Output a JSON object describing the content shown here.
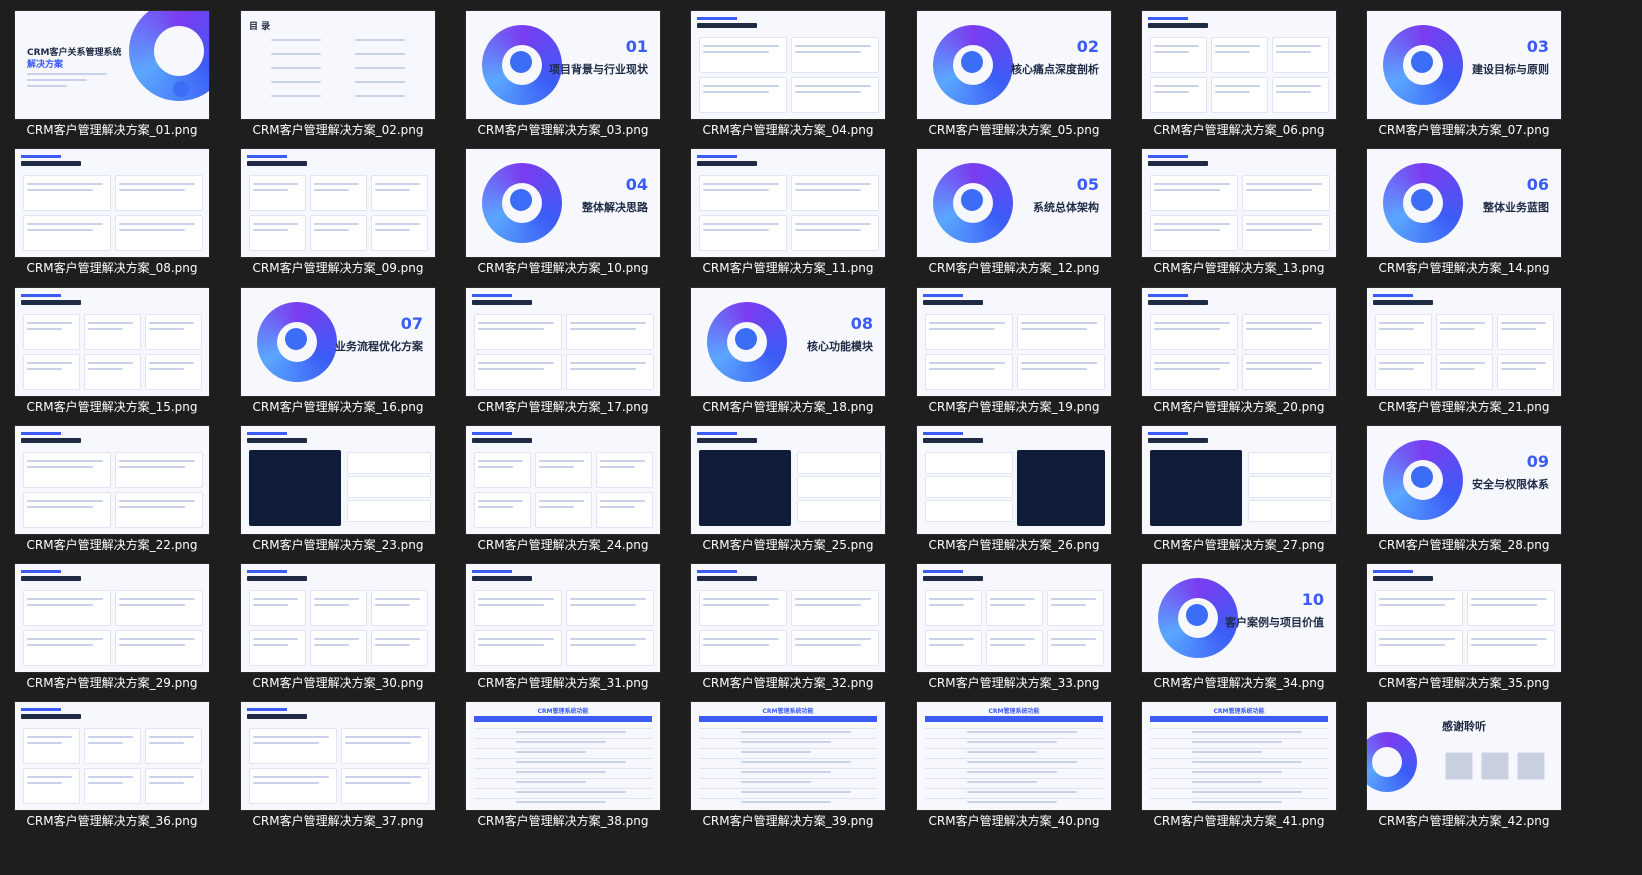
{
  "files": [
    {
      "name": "CRM客户管理解决方案_01.png",
      "kind": "cover"
    },
    {
      "name": "CRM客户管理解决方案_02.png",
      "kind": "toc"
    },
    {
      "name": "CRM客户管理解决方案_03.png",
      "kind": "section"
    },
    {
      "name": "CRM客户管理解决方案_04.png",
      "kind": "content"
    },
    {
      "name": "CRM客户管理解决方案_05.png",
      "kind": "section"
    },
    {
      "name": "CRM客户管理解决方案_06.png",
      "kind": "content"
    },
    {
      "name": "CRM客户管理解决方案_07.png",
      "kind": "section"
    },
    {
      "name": "CRM客户管理解决方案_08.png",
      "kind": "content"
    },
    {
      "name": "CRM客户管理解决方案_09.png",
      "kind": "content"
    },
    {
      "name": "CRM客户管理解决方案_10.png",
      "kind": "section"
    },
    {
      "name": "CRM客户管理解决方案_11.png",
      "kind": "content"
    },
    {
      "name": "CRM客户管理解决方案_12.png",
      "kind": "section"
    },
    {
      "name": "CRM客户管理解决方案_13.png",
      "kind": "content"
    },
    {
      "name": "CRM客户管理解决方案_14.png",
      "kind": "section"
    },
    {
      "name": "CRM客户管理解决方案_15.png",
      "kind": "content"
    },
    {
      "name": "CRM客户管理解决方案_16.png",
      "kind": "section"
    },
    {
      "name": "CRM客户管理解决方案_17.png",
      "kind": "content"
    },
    {
      "name": "CRM客户管理解决方案_18.png",
      "kind": "section"
    },
    {
      "name": "CRM客户管理解决方案_19.png",
      "kind": "content"
    },
    {
      "name": "CRM客户管理解决方案_20.png",
      "kind": "content"
    },
    {
      "name": "CRM客户管理解决方案_21.png",
      "kind": "content"
    },
    {
      "name": "CRM客户管理解决方案_22.png",
      "kind": "content"
    },
    {
      "name": "CRM客户管理解决方案_23.png",
      "kind": "dashboard"
    },
    {
      "name": "CRM客户管理解决方案_24.png",
      "kind": "content"
    },
    {
      "name": "CRM客户管理解决方案_25.png",
      "kind": "dashboard"
    },
    {
      "name": "CRM客户管理解决方案_26.png",
      "kind": "dashboard"
    },
    {
      "name": "CRM客户管理解决方案_27.png",
      "kind": "dashboard"
    },
    {
      "name": "CRM客户管理解决方案_28.png",
      "kind": "section"
    },
    {
      "name": "CRM客户管理解决方案_29.png",
      "kind": "content"
    },
    {
      "name": "CRM客户管理解决方案_30.png",
      "kind": "content"
    },
    {
      "name": "CRM客户管理解决方案_31.png",
      "kind": "content"
    },
    {
      "name": "CRM客户管理解决方案_32.png",
      "kind": "content"
    },
    {
      "name": "CRM客户管理解决方案_33.png",
      "kind": "content"
    },
    {
      "name": "CRM客户管理解决方案_34.png",
      "kind": "section"
    },
    {
      "name": "CRM客户管理解决方案_35.png",
      "kind": "content"
    },
    {
      "name": "CRM客户管理解决方案_36.png",
      "kind": "content"
    },
    {
      "name": "CRM客户管理解决方案_37.png",
      "kind": "content"
    },
    {
      "name": "CRM客户管理解决方案_38.png",
      "kind": "table"
    },
    {
      "name": "CRM客户管理解决方案_39.png",
      "kind": "table"
    },
    {
      "name": "CRM客户管理解决方案_40.png",
      "kind": "table"
    },
    {
      "name": "CRM客户管理解决方案_41.png",
      "kind": "table"
    },
    {
      "name": "CRM客户管理解决方案_42.png",
      "kind": "thanks"
    }
  ],
  "slides": {
    "cover": {
      "title": "CRM客户关系管理系统",
      "subtitle": "解决方案"
    },
    "toc": {
      "title": "目 录"
    },
    "s03": {
      "num": "01",
      "title": "项目背景与行业现状"
    },
    "s05": {
      "num": "02",
      "title": "核心痛点深度剖析"
    },
    "s07": {
      "num": "03",
      "title": "建设目标与原则"
    },
    "s10": {
      "num": "04",
      "title": "整体解决思路"
    },
    "s12": {
      "num": "05",
      "title": "系统总体架构"
    },
    "s14": {
      "num": "06",
      "title": "整体业务蓝图"
    },
    "s16": {
      "num": "07",
      "title": "业务流程优化方案"
    },
    "s18": {
      "num": "08",
      "title": "核心功能模块"
    },
    "s28": {
      "num": "09",
      "title": "安全与权限体系"
    },
    "s34": {
      "num": "10",
      "title": "客户案例与项目价值"
    },
    "tables": {
      "title": "CRM管理系统功能"
    },
    "thanks": {
      "title": "感谢聆听"
    }
  },
  "colors": {
    "background": "#1e1e1e",
    "caption": "#ffffff",
    "accent": "#3b5cf6",
    "slide_bg": "#f6f8fe"
  }
}
